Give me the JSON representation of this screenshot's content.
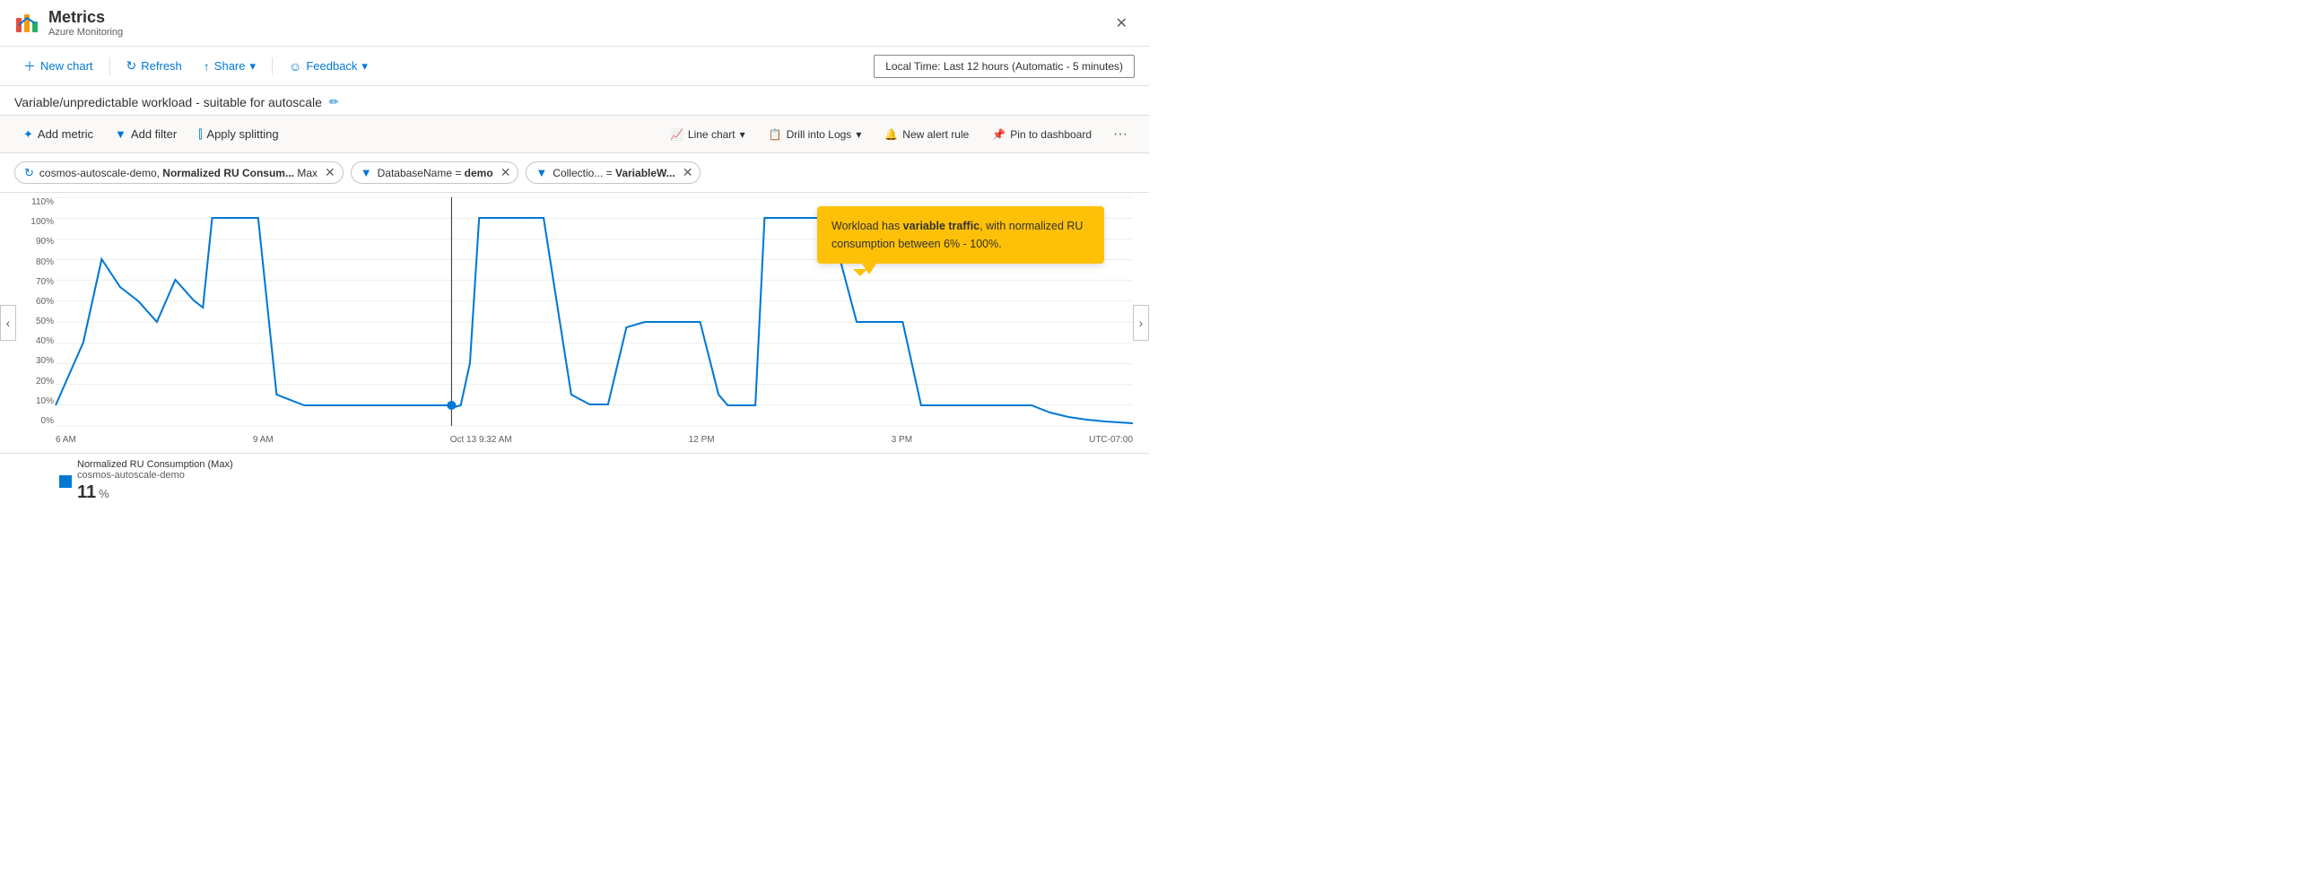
{
  "titleBar": {
    "appTitle": "Metrics",
    "appSubtitle": "Azure Monitoring",
    "closeLabel": "✕"
  },
  "toolbar": {
    "newChartLabel": "New chart",
    "refreshLabel": "Refresh",
    "shareLabel": "Share",
    "feedbackLabel": "Feedback",
    "timeRangeLabel": "Local Time: Last 12 hours (Automatic - 5 minutes)"
  },
  "chartTitle": {
    "title": "Variable/unpredictable workload - suitable for autoscale",
    "editIcon": "✏"
  },
  "metricsToolbar": {
    "addMetricLabel": "Add metric",
    "addFilterLabel": "Add filter",
    "applySplittingLabel": "Apply splitting",
    "lineChartLabel": "Line chart",
    "drillIntoLogsLabel": "Drill into Logs",
    "newAlertRuleLabel": "New alert rule",
    "pinToDashboardLabel": "Pin to dashboard",
    "moreLabel": "···"
  },
  "filters": [
    {
      "icon": "↻",
      "text": "cosmos-autoscale-demo, ",
      "boldText": "Normalized RU Consum...",
      "suffix": " Max",
      "removable": true
    },
    {
      "icon": "▼",
      "text": "DatabaseName = ",
      "boldText": "demo",
      "removable": true
    },
    {
      "icon": "▼",
      "text": "Collectio... = ",
      "boldText": "VariableW...",
      "removable": true
    }
  ],
  "yAxis": {
    "labels": [
      "110%",
      "100%",
      "90%",
      "80%",
      "70%",
      "60%",
      "50%",
      "40%",
      "30%",
      "20%",
      "10%",
      "0%"
    ]
  },
  "xAxis": {
    "labels": [
      "6 AM",
      "9 AM",
      "Oct 13 9:32 AM",
      "12 PM",
      "3 PM",
      "UTC-07:00"
    ]
  },
  "tooltip": {
    "text": "Workload has ",
    "boldText": "variable traffic",
    "suffix": ", with normalized RU consumption between 6% - 100%."
  },
  "legend": {
    "colorLabel": "Normalized RU Consumption (Max)",
    "subLabel": "cosmos-autoscale-demo",
    "value": "11",
    "unit": "%"
  },
  "chart": {
    "accentColor": "#0078d4",
    "gridColor": "#e1dfdd"
  }
}
